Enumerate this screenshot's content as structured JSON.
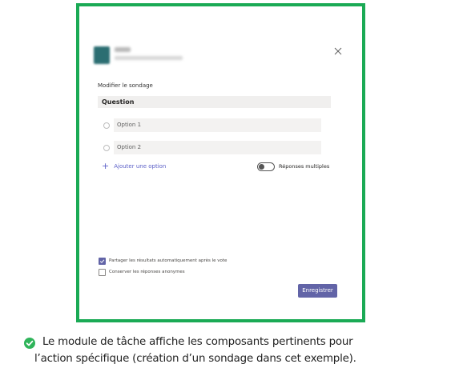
{
  "dialog": {
    "section_title": "Modifier le sondage",
    "question_placeholder": "Question",
    "options": [
      {
        "placeholder": "Option 1"
      },
      {
        "placeholder": "Option 2"
      }
    ],
    "add_option_label": "Ajouter une option",
    "add_option_icon": "plus-icon",
    "multiple_responses": {
      "label": "Réponses multiples",
      "enabled": false
    },
    "checkboxes": [
      {
        "label": "Partager les résultats automatiquement après le vote",
        "checked": true
      },
      {
        "label": "Conserver les réponses anonymes",
        "checked": false
      }
    ],
    "save_label": "Enregistrer",
    "close_icon": "close-icon",
    "accent_color": "#6264a7",
    "frame_color": "#1aaa55"
  },
  "caption": {
    "icon": "check-circle-icon",
    "line1": "Le module de tâche affiche les composants pertinents pour",
    "line2": "l’action spécifique (création d’un sondage dans cet exemple)."
  }
}
